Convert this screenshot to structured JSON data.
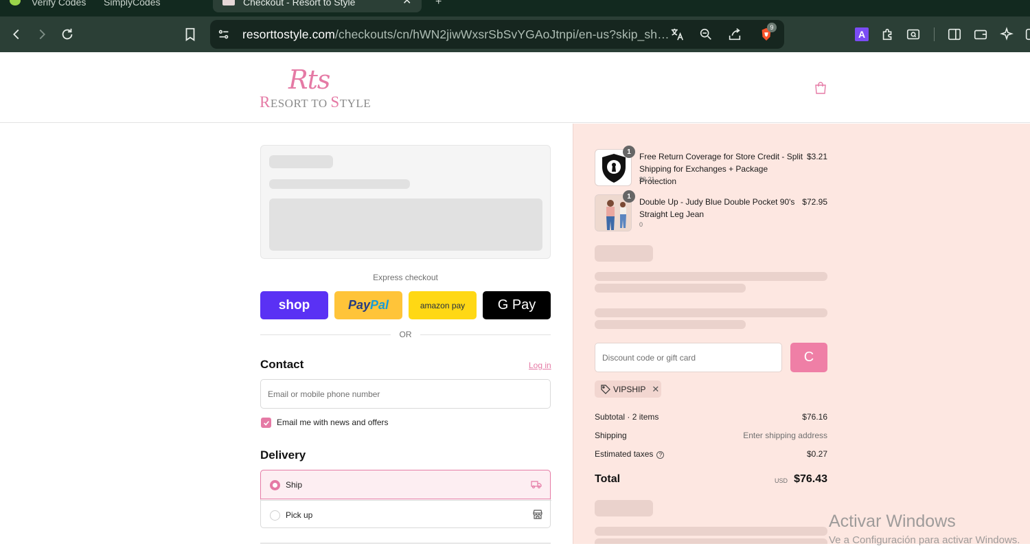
{
  "browser": {
    "tabs": [
      {
        "label": "Verify Codes"
      },
      {
        "label": "SimplyCodes"
      }
    ],
    "active_tab": {
      "label": "Checkout - Resort to Style"
    },
    "url_domain": "resorttostyle.com",
    "url_path": "/checkouts/cn/hWN2jiwWxsrSbSvYGAoJtnpi/en-us?skip_sh…",
    "brave_badge": "9",
    "extension_letter": "A"
  },
  "header": {
    "logo_mark": "Rts",
    "logo_text_1": "R",
    "logo_text_2": "esort to ",
    "logo_text_3": "S",
    "logo_text_4": "tyle"
  },
  "checkout": {
    "express_label": "Express checkout",
    "pay_buttons": {
      "shop": "shop",
      "paypal_a": "Pay",
      "paypal_b": "Pal",
      "amazon": "amazon pay",
      "gpay": "G Pay"
    },
    "or_label": "OR",
    "contact_heading": "Contact",
    "login_link": "Log in",
    "email_placeholder": "Email or mobile phone number",
    "news_checkbox_label": "Email me with news and offers",
    "news_checked": true,
    "delivery_heading": "Delivery",
    "delivery_options": [
      {
        "label": "Ship",
        "selected": true
      },
      {
        "label": "Pick up",
        "selected": false
      }
    ]
  },
  "summary": {
    "items": [
      {
        "qty": "1",
        "name": "Free Return Coverage for Store Credit - Split Shipping for Exchanges + Package Protection",
        "sub": "$3.21",
        "price": "$3.21"
      },
      {
        "qty": "1",
        "name": "Double Up - Judy Blue Double Pocket 90's Straight Leg Jean",
        "sub": "0",
        "price": "$72.95"
      }
    ],
    "discount_placeholder": "Discount code or gift card",
    "applied_code": "VIPSHIP",
    "subtotal_label": "Subtotal · 2 items",
    "subtotal_value": "$76.16",
    "shipping_label": "Shipping",
    "shipping_value": "Enter shipping address",
    "taxes_label": "Estimated taxes",
    "taxes_value": "$0.27",
    "total_label": "Total",
    "total_currency": "USD",
    "total_value": "$76.43"
  },
  "os_watermark": {
    "line1": "Activar Windows",
    "line2": "Ve a Configuración para activar Windows."
  },
  "colors": {
    "accent_pink": "#e57aa5",
    "summary_bg": "#fde7e1",
    "shop_purple": "#5a31f4",
    "paypal_yellow": "#ffc439",
    "amazon_yellow": "#ffd814"
  }
}
